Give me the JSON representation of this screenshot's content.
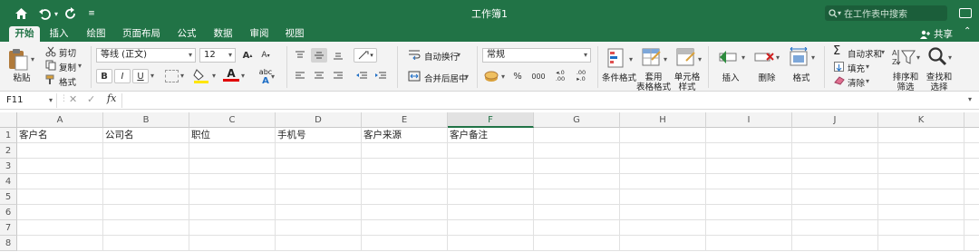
{
  "titlebar": {
    "title": "工作簿1",
    "search_placeholder": "在工作表中搜索"
  },
  "tabs": [
    "开始",
    "插入",
    "绘图",
    "页面布局",
    "公式",
    "数据",
    "审阅",
    "视图"
  ],
  "share_label": "共享",
  "ribbon": {
    "paste_label": "粘贴",
    "cut_label": "剪切",
    "copy_label": "复制",
    "format_painter_label": "格式",
    "font_name": "等线 (正文)",
    "font_size": "12",
    "grow_font": "A",
    "shrink_font": "A",
    "bold": "B",
    "italic": "I",
    "underline": "U",
    "font_color_letter": "A",
    "phonetic": "abc",
    "wrap_text_label": "自动换行",
    "merge_center_label": "合并后居中",
    "number_format": "常规",
    "percent": "%",
    "comma": "000",
    "conditional_format_label": "条件格式",
    "table_format_label_1": "套用",
    "table_format_label_2": "表格格式",
    "cell_style_label_1": "单元格",
    "cell_style_label_2": "样式",
    "insert_label": "插入",
    "delete_label": "删除",
    "format_label": "格式",
    "autosum_label": "自动求和",
    "fill_label": "填充",
    "clear_label": "清除",
    "sort_filter_label_1": "排序和",
    "sort_filter_label_2": "筛选",
    "find_select_label_1": "查找和",
    "find_select_label_2": "选择"
  },
  "formula_bar": {
    "name_box": "F11",
    "fx": "fx",
    "cancel": "✕",
    "confirm": "✓",
    "value": ""
  },
  "sheet": {
    "columns": [
      "A",
      "B",
      "C",
      "D",
      "E",
      "F",
      "G",
      "H",
      "I",
      "J",
      "K"
    ],
    "rows": [
      "1",
      "2",
      "3",
      "4",
      "5",
      "6",
      "7",
      "8"
    ],
    "header_row": [
      "客户名",
      "公司名",
      "职位",
      "手机号",
      "客户来源",
      "客户备注",
      "",
      "",
      "",
      "",
      ""
    ],
    "selected_column": "F"
  },
  "colors": {
    "accent": "#217346",
    "yellow_fill": "#ffe600",
    "red_font": "#e00000"
  }
}
